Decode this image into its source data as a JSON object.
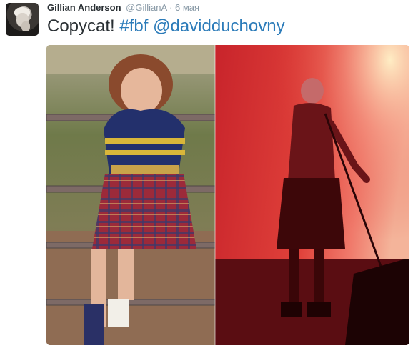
{
  "tweet": {
    "author_name": "Gillian Anderson",
    "author_handle": "@GillianA",
    "separator": "·",
    "timestamp": "6 мая",
    "text_plain": "Copycat!",
    "hashtag": "#fbf",
    "mention": "@davidduchovny"
  },
  "media": {
    "left_photo": "girl-in-kilt-on-gate",
    "right_photo": "man-in-kilt-on-stage"
  },
  "colors": {
    "link": "#2b7bb9",
    "name": "#292f33",
    "meta": "#8899a6",
    "stage_red": "#e0413a"
  }
}
